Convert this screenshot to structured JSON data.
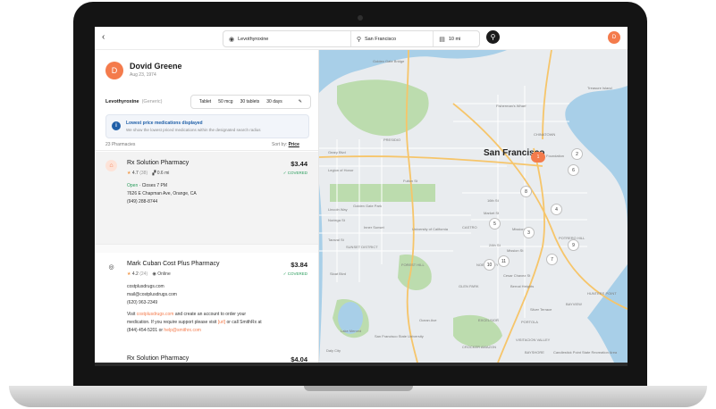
{
  "topbar": {
    "back_icon": "‹",
    "medication": "Levothyroxine",
    "location": "San Francisco",
    "radius": "10 mi"
  },
  "patient": {
    "initial": "D",
    "name": "Dovid Greene",
    "dob": "Aug 23, 1974"
  },
  "medication": {
    "name": "Levothyroxine",
    "generic": "(Generic)",
    "form": "Tablet",
    "dose": "50 mcg",
    "qty": "30 tablets",
    "days": "30 days"
  },
  "notice": {
    "title": "Lowest price medications displayed",
    "body": "We show the lowest priced medications within the designated search radius"
  },
  "list": {
    "count": "23 Pharmacies",
    "sort_label": "Sort by:",
    "sort_value": "Price"
  },
  "pharmacies": [
    {
      "name": "Rx Solution Pharmacy",
      "price": "$3.44",
      "coverage": "COVERED",
      "rating": "4.7",
      "reviews": "(38)",
      "distance": "0.6 mi",
      "status": "Open",
      "hours": "Closes 7 PM",
      "address": "7626 E Chapman Ave, Orange, CA",
      "phone": "(949) 288-8744"
    },
    {
      "name": "Mark Cuban Cost Plus Pharmacy",
      "price": "$3.84",
      "coverage": "COVERED",
      "rating": "4.2",
      "reviews": "(24)",
      "mode": "Online",
      "site": "costplusdrugs.com",
      "email": "mail@costplusdrugs.com",
      "phone": "(620) 963-2349",
      "visit_prefix": "Visit ",
      "visit_link": "costplusdrugs.com",
      "visit_mid": " and create an account to order your",
      "visit_line2": "medication. If you require support please visit ",
      "visit_link2": "[url]",
      "visit_line2_end": " or call SmithRx at",
      "visit_line3": "(844) 454-5201 or ",
      "visit_link3": "help@smithrx.com"
    },
    {
      "name": "Rx Solution Pharmacy",
      "price": "$4.04"
    }
  ],
  "map": {
    "city": "San Francisco",
    "labels": [
      "Fisherman's Wharf",
      "Legion of Honor",
      "PRESIDIO",
      "Inner Sunset",
      "Golden Gate Park",
      "SUNSET DISTRICT",
      "FOREST HILL",
      "Mission",
      "CASTRO",
      "HUNTERS POINT",
      "GLEN PARK",
      "Daly City",
      "San Francisco State University",
      "Silver Terrace",
      "Candlestick Point State Recreation Area",
      "NOE VALLEY",
      "POTRERO HILL",
      "CHINATOWN",
      "Golden Gate Bridge",
      "University of California",
      "Bernal Heights",
      "EXCELSIOR",
      "BAYVIEW",
      "Lake Merced",
      "Treasure Island",
      "CROCKER AMAZON",
      "PORTOLA",
      "BAYSHORE",
      "VISITACION VALLEY",
      "Ocean Ave",
      "Sloat Blvd",
      "Geary Blvd",
      "Fulton St",
      "Lincoln Way",
      "Noriega St",
      "Taraval St",
      "Market St",
      "Cesar Chavez St",
      "Mission St",
      "16th St",
      "24th St"
    ],
    "pins": [
      "1",
      "2",
      "3",
      "4",
      "5",
      "6",
      "7",
      "8",
      "9",
      "10",
      "11"
    ],
    "pin_label": "Foundation"
  },
  "colors": {
    "accent": "#f47b4c",
    "covered": "#2a9d5c",
    "info": "#1f5fa8",
    "star": "#f2994a"
  }
}
